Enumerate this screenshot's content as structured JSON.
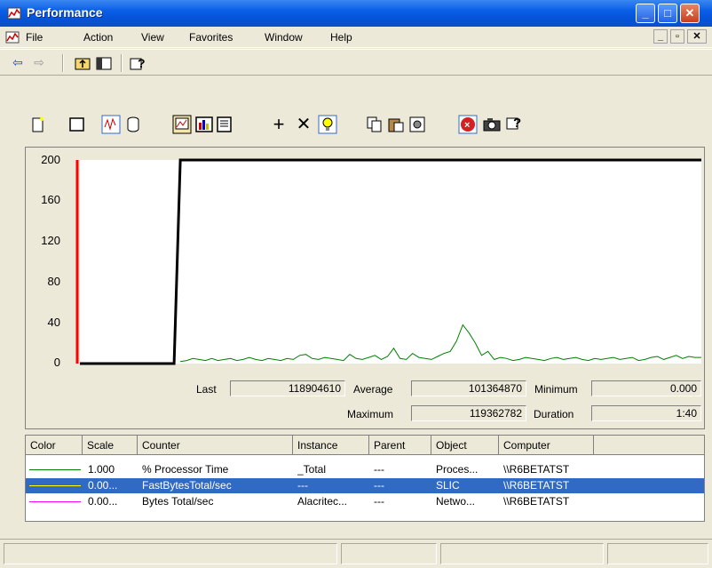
{
  "window": {
    "title": "Performance"
  },
  "menu": [
    "File",
    "Action",
    "View",
    "Favorites",
    "Window",
    "Help"
  ],
  "chart_data": {
    "type": "line",
    "ylim": [
      0,
      200
    ],
    "yticks": [
      "200",
      "160",
      "120",
      "80",
      "40",
      "0"
    ],
    "series": [
      {
        "color": "#000000",
        "y": [
          0,
          0,
          0,
          0,
          0,
          0,
          0,
          0,
          0,
          0,
          0,
          0,
          0,
          0,
          0,
          0,
          200,
          200,
          200,
          200,
          200,
          200,
          200,
          200,
          200,
          200,
          200,
          200,
          200,
          200,
          200,
          200,
          200,
          200,
          200,
          200,
          200,
          200,
          200,
          200,
          200,
          200,
          200,
          200,
          200,
          200,
          200,
          200,
          200,
          200,
          200,
          200,
          200,
          200,
          200,
          200,
          200,
          200,
          200,
          200,
          200,
          200,
          200,
          200,
          200,
          200,
          200,
          200,
          200,
          200,
          200,
          200,
          200,
          200,
          200,
          200,
          200,
          200,
          200,
          200,
          200,
          200,
          200,
          200,
          200,
          200,
          200,
          200,
          200,
          200,
          200,
          200,
          200,
          200,
          200,
          200,
          200,
          200,
          200,
          200
        ]
      },
      {
        "color": "#008000",
        "y": [
          null,
          null,
          null,
          null,
          null,
          null,
          null,
          null,
          null,
          null,
          null,
          null,
          null,
          null,
          null,
          null,
          2,
          3,
          5,
          4,
          3,
          5,
          3,
          4,
          5,
          3,
          4,
          6,
          4,
          3,
          5,
          4,
          3,
          5,
          4,
          8,
          9,
          5,
          4,
          6,
          5,
          4,
          3,
          9,
          5,
          4,
          6,
          8,
          4,
          7,
          15,
          5,
          4,
          10,
          6,
          5,
          4,
          7,
          10,
          12,
          22,
          38,
          30,
          20,
          8,
          12,
          4,
          6,
          5,
          3,
          4,
          6,
          5,
          4,
          3,
          5,
          6,
          4,
          5,
          6,
          4,
          3,
          5,
          4,
          5,
          6,
          4,
          5,
          6,
          3,
          4,
          6,
          7,
          4,
          6,
          8,
          5,
          7,
          6,
          6
        ]
      }
    ],
    "cursor_color": "#ff0000"
  },
  "stats": {
    "last_label": "Last",
    "last_value": "118904610",
    "average_label": "Average",
    "average_value": "101364870",
    "minimum_label": "Minimum",
    "minimum_value": "0.000",
    "maximum_label": "Maximum",
    "maximum_value": "119362782",
    "duration_label": "Duration",
    "duration_value": "1:40"
  },
  "table": {
    "headers": [
      "Color",
      "Scale",
      "Counter",
      "Instance",
      "Parent",
      "Object",
      "Computer"
    ],
    "rows": [
      {
        "color": "#008000",
        "scale": "1.000",
        "counter": "% Processor Time",
        "instance": "_Total",
        "parent": "---",
        "object": "Proces...",
        "computer": "\\\\R6BETATST"
      },
      {
        "color": "#ffff00",
        "scale": "0.00...",
        "counter": "FastBytesTotal/sec",
        "instance": "---",
        "parent": "---",
        "object": "SLIC",
        "computer": "\\\\R6BETATST"
      },
      {
        "color": "#ff00ff",
        "scale": "0.00...",
        "counter": "Bytes Total/sec",
        "instance": "Alacritec...",
        "parent": "---",
        "object": "Netwo...",
        "computer": "\\\\R6BETATST"
      }
    ]
  }
}
